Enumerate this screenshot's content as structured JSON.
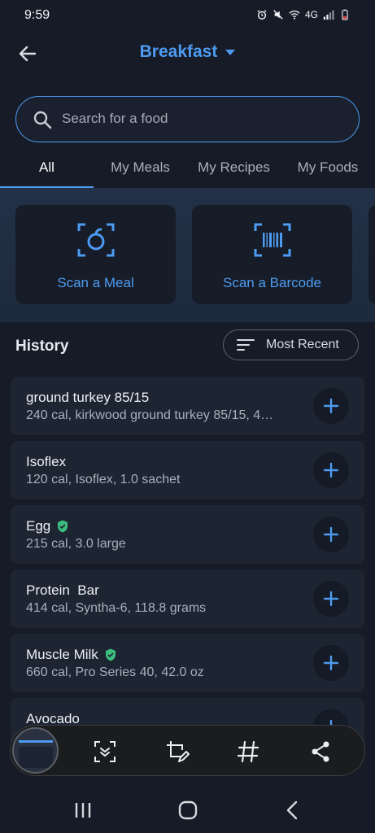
{
  "status_bar": {
    "time": "9:59",
    "network": "4G"
  },
  "header": {
    "back_icon": "arrow-left-icon",
    "title": "Breakfast"
  },
  "search": {
    "placeholder": "Search for a food",
    "value": ""
  },
  "tabs": [
    {
      "label": "All",
      "active": true
    },
    {
      "label": "My Meals",
      "active": false
    },
    {
      "label": "My Recipes",
      "active": false
    },
    {
      "label": "My Foods",
      "active": false
    }
  ],
  "scan": {
    "meal_label": "Scan a Meal",
    "barcode_label": "Scan a Barcode"
  },
  "history": {
    "title": "History",
    "sort_label": "Most Recent",
    "items": [
      {
        "name": "ground turkey 85/15",
        "desc": "240 cal, kirkwood ground turkey 85/15, 4…",
        "verified": false
      },
      {
        "name": "Isoflex",
        "desc": "120 cal, Isoflex, 1.0 sachet",
        "verified": false
      },
      {
        "name": "Egg",
        "desc": "215 cal, 3.0 large",
        "verified": true
      },
      {
        "name": "Protein  Bar",
        "desc": "414 cal, Syntha-6, 118.8 grams",
        "verified": false
      },
      {
        "name": "Muscle Milk",
        "desc": "660 cal, Pro Series 40, 42.0 oz",
        "verified": true
      },
      {
        "name": "Avocado",
        "desc": "",
        "verified": false
      }
    ]
  },
  "colors": {
    "accent": "#4d9bf0",
    "background": "#161b27",
    "card": "#1d2432",
    "verified": "#3dbd7d"
  }
}
